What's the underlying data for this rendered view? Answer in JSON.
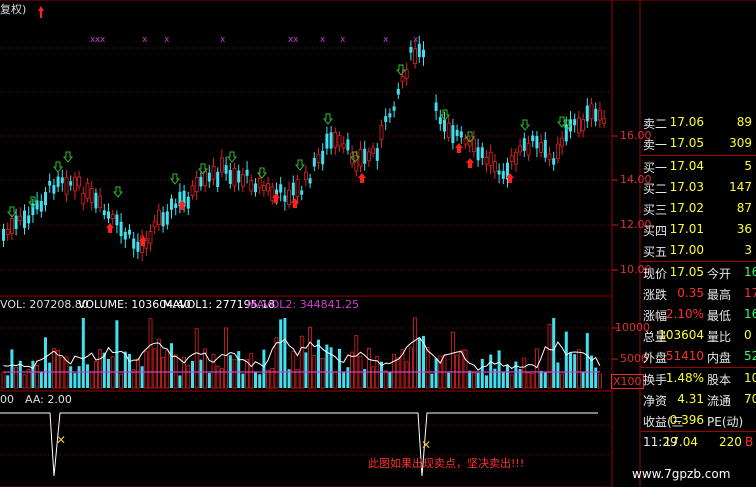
{
  "title": {
    "text": "复权)"
  },
  "volume_header": {
    "vol": "VOL: 207208.80",
    "volume": "VOLUME: 103604.40",
    "mavol1": "MAVOL1: 277195.18",
    "mavol2": "MAVOL2: 344841.25"
  },
  "indicator_header": {
    "label": "00",
    "aa": "AA: 2.00"
  },
  "price_axis": [
    "16.00",
    "14.00",
    "12.00",
    "10.00"
  ],
  "volume_axis": [
    "10000",
    "5000",
    "X100"
  ],
  "quote": {
    "asks": [
      {
        "label": "卖二",
        "price": "17.06",
        "size": "89"
      },
      {
        "label": "卖一",
        "price": "17.05",
        "size": "309"
      }
    ],
    "bids": [
      {
        "label": "买一",
        "price": "17.04",
        "size": "5"
      },
      {
        "label": "买二",
        "price": "17.03",
        "size": "147"
      },
      {
        "label": "买三",
        "price": "17.02",
        "size": "87"
      },
      {
        "label": "买四",
        "price": "17.01",
        "size": "36"
      },
      {
        "label": "买五",
        "price": "17.00",
        "size": "3"
      }
    ],
    "stats": [
      {
        "l1": "现价",
        "v1": "17.05",
        "l2": "今开",
        "v2": "16"
      },
      {
        "l1": "涨跌",
        "v1": "0.35",
        "l2": "最高",
        "v2": "17"
      },
      {
        "l1": "涨幅",
        "v1": "2.10%",
        "l2": "最低",
        "v2": "16"
      },
      {
        "l1": "总量",
        "v1": "103604",
        "l2": "量比",
        "v2": "0"
      },
      {
        "l1": "外盘",
        "v1": "51410",
        "l2": "内盘",
        "v2": "52"
      }
    ],
    "fundamentals": [
      {
        "l1": "换手",
        "v1": "1.48%",
        "l2": "股本",
        "v2": "10"
      },
      {
        "l1": "净资",
        "v1": "4.31",
        "l2": "流通",
        "v2": "70"
      },
      {
        "l1": "收益(三",
        "v1": "0.396",
        "l2": "PE(动)",
        "v2": ""
      }
    ],
    "tick": {
      "time": "11:29",
      "price": "17.04",
      "volume": "220",
      "side": "B"
    }
  },
  "warning_text": "此图如果出现卖点，坚决卖出!!!",
  "watermark": "www.7gpzb.com",
  "colors": {
    "up": "#e02020",
    "down": "#40e0f0",
    "buy_arrow": "#ff2020",
    "sell_arrow": "#30c030",
    "mavol1": "#ffffff",
    "mavol2": "#d040d0"
  }
}
